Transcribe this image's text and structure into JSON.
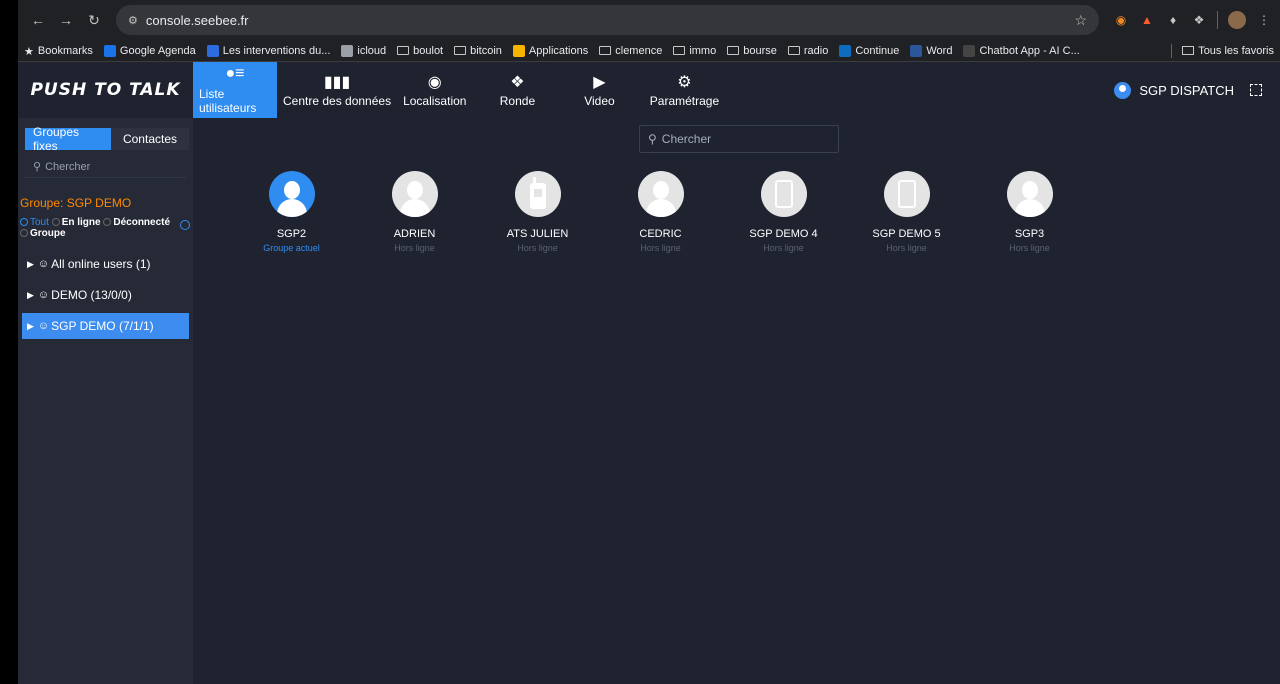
{
  "browser": {
    "url": "console.seebee.fr",
    "bookmarks": [
      {
        "label": "Bookmarks",
        "icon": "star-icon"
      },
      {
        "label": "Google Agenda",
        "icon": "calendar-icon"
      },
      {
        "label": "Les interventions du...",
        "icon": "s-icon"
      },
      {
        "label": "icloud",
        "icon": "apple-icon"
      },
      {
        "label": "boulot",
        "icon": "folder-icon"
      },
      {
        "label": "bitcoin",
        "icon": "folder-icon"
      },
      {
        "label": "Applications",
        "icon": "apps-icon"
      },
      {
        "label": "clemence",
        "icon": "folder-icon"
      },
      {
        "label": "immo",
        "icon": "folder-icon"
      },
      {
        "label": "bourse",
        "icon": "folder-icon"
      },
      {
        "label": "radio",
        "icon": "folder-icon"
      },
      {
        "label": "Continue",
        "icon": "outlook-icon"
      },
      {
        "label": "Word",
        "icon": "word-icon"
      },
      {
        "label": "Chatbot App - AI C...",
        "icon": "chatbot-icon"
      }
    ],
    "all_bookmarks": "Tous les favoris"
  },
  "app": {
    "logo": "PUSH TO TALK",
    "tabs": [
      {
        "label": "Liste utilisateurs",
        "icon": "user-list-icon",
        "active": true
      },
      {
        "label": "Centre des données",
        "icon": "bar-chart-icon",
        "active": false
      },
      {
        "label": "Localisation",
        "icon": "location-pin-icon",
        "active": false
      },
      {
        "label": "Ronde",
        "icon": "route-icon",
        "active": false
      },
      {
        "label": "Video",
        "icon": "play-icon",
        "active": false
      },
      {
        "label": "Paramétrage",
        "icon": "gear-icon",
        "active": false
      }
    ],
    "current_user": "SGP DISPATCH"
  },
  "sidebar": {
    "segments": [
      "Groupes fixes",
      "Contactes"
    ],
    "search_placeholder": "Chercher",
    "group_title": "Groupe: SGP DEMO",
    "filters": {
      "all": "Tout",
      "online": "En ligne",
      "offline": "Déconnecté",
      "group": "Groupe"
    },
    "groups": [
      {
        "label": "All online users (1)"
      },
      {
        "label": "DEMO (13/0/0)"
      },
      {
        "label": "SGP DEMO (7/1/1)",
        "selected": true
      }
    ]
  },
  "main": {
    "search_placeholder": "Chercher",
    "users": [
      {
        "name": "SGP2",
        "status": "Groupe actuel",
        "avatar": "person",
        "current": true
      },
      {
        "name": "ADRIEN",
        "status": "Hors ligne",
        "avatar": "person"
      },
      {
        "name": "ATS JULIEN",
        "status": "Hors ligne",
        "avatar": "walkie"
      },
      {
        "name": "CEDRIC",
        "status": "Hors ligne",
        "avatar": "person"
      },
      {
        "name": "SGP DEMO 4",
        "status": "Hors ligne",
        "avatar": "phone"
      },
      {
        "name": "SGP DEMO 5",
        "status": "Hors ligne",
        "avatar": "phone"
      },
      {
        "name": "SGP3",
        "status": "Hors ligne",
        "avatar": "person"
      }
    ]
  },
  "colors": {
    "accent": "#2f8cf0",
    "orange": "#ff8a00",
    "background": "#1f2330",
    "sidebar": "#262a37"
  }
}
